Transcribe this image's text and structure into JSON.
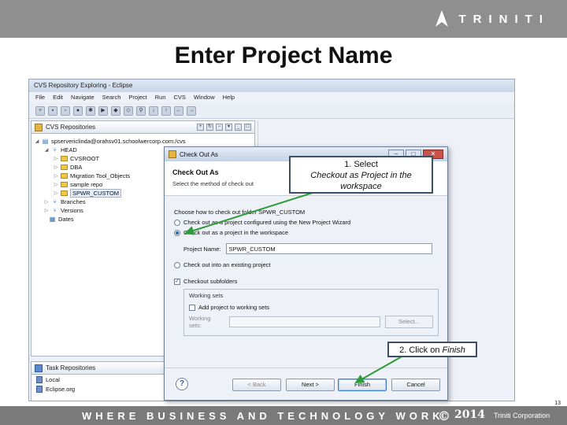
{
  "header": {
    "logo_text": "TRINITI",
    "slide_title": "Enter Project Name"
  },
  "colors": {
    "header_band": "#8f8f8f",
    "footer_band": "#7a7a7a",
    "callout_border": "#3d4f66",
    "arrow": "#2f9c3a"
  },
  "eclipse": {
    "title": "CVS Repository Exploring - Eclipse",
    "menu": [
      "File",
      "Edit",
      "Navigate",
      "Search",
      "Project",
      "Run",
      "CVS",
      "Window",
      "Help"
    ],
    "repo_tab_label": "CVS Repositories",
    "tree": [
      {
        "label": "spservericlinda@orahsv01.schoolwercorp.com:/cvs",
        "icon": "repository-icon"
      },
      {
        "label": "HEAD",
        "icon": "branch-icon"
      },
      {
        "label": "CVSROOT",
        "icon": "folder-icon"
      },
      {
        "label": "DBA",
        "icon": "folder-icon"
      },
      {
        "label": "Migration Tool_Objects",
        "icon": "folder-icon"
      },
      {
        "label": "sample repo",
        "icon": "folder-icon"
      },
      {
        "label": "SPWR_CUSTOM",
        "icon": "folder-icon"
      },
      {
        "label": "Branches",
        "icon": "branch-icon"
      },
      {
        "label": "Versions",
        "icon": "branch-icon"
      },
      {
        "label": "Dates",
        "icon": "calendar-icon"
      }
    ],
    "task_tab_label": "Task Repositories",
    "task_repos": [
      "Local",
      "Eclipse.org"
    ]
  },
  "dialog": {
    "title": "Check Out As",
    "banner_title": "Check Out As",
    "banner_subtitle": "Select the method of check out",
    "choose_label": "Choose how to check out folder SPWR_CUSTOM",
    "option_wizard": "Check out as a project configured using the New Project Wizard",
    "option_workspace": "Check out as a project in the workspace",
    "project_name_label": "Project Name:",
    "project_name_value": "SPWR_CUSTOM",
    "option_existing": "Check out into an existing project",
    "subfolders_label": "Checkout subfolders",
    "working_sets_label": "Working sets",
    "add_working_sets_label": "Add project to working sets",
    "working_sets_field_label": "Working sets:",
    "select_button": "Select...",
    "back_button": "< Back",
    "next_button": "Next >",
    "finish_button": "Finish",
    "cancel_button": "Cancel",
    "help_symbol": "?"
  },
  "callouts": {
    "step1_label": "1. Select",
    "step1_detail": "Checkout as Project in the workspace",
    "step2_label": "2. Click on ",
    "step2_emphasis": "Finish"
  },
  "footer": {
    "tagline": "WHERE BUSINESS AND TECHNOLOGY WORK",
    "copyright_symbol": "©",
    "year": "2014",
    "corporation": "Triniti Corporation",
    "page_number": "13"
  }
}
